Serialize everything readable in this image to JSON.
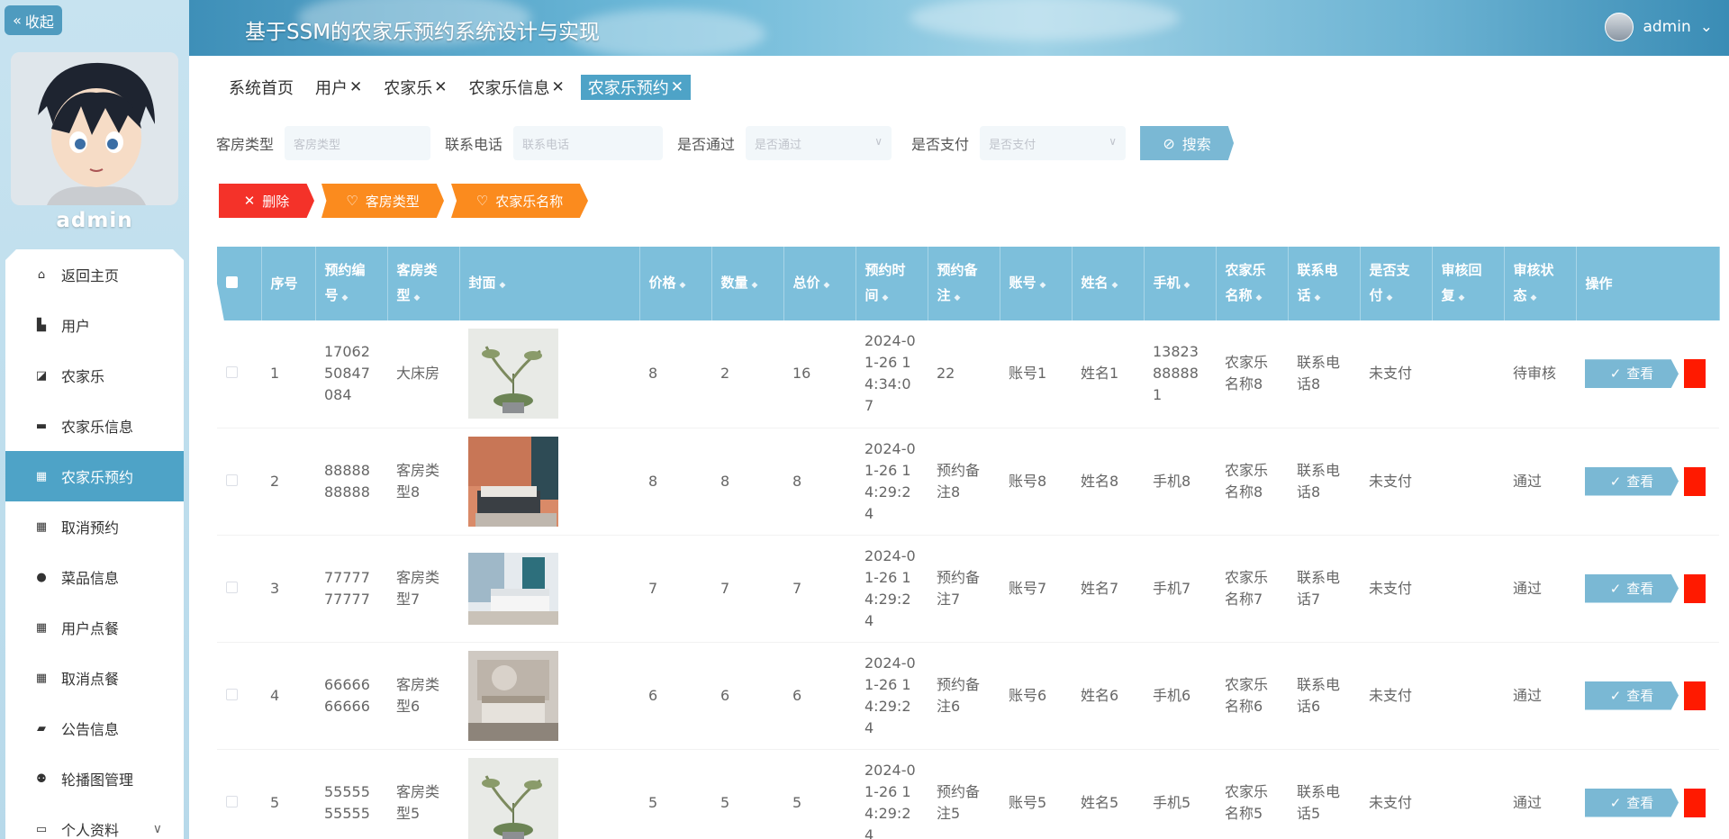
{
  "sidebar": {
    "collapse_label": "收起",
    "username": "admin",
    "menu": [
      {
        "label": "返回主页",
        "icon": "home-icon"
      },
      {
        "label": "用户",
        "icon": "user-group-icon"
      },
      {
        "label": "农家乐",
        "icon": "chart-icon"
      },
      {
        "label": "农家乐信息",
        "icon": "monitor-icon"
      },
      {
        "label": "农家乐预约",
        "icon": "grid-icon",
        "active": true
      },
      {
        "label": "取消预约",
        "icon": "grid-icon"
      },
      {
        "label": "菜品信息",
        "icon": "bulb-icon"
      },
      {
        "label": "用户点餐",
        "icon": "grid-icon"
      },
      {
        "label": "取消点餐",
        "icon": "grid-icon"
      },
      {
        "label": "公告信息",
        "icon": "notice-icon"
      },
      {
        "label": "轮播图管理",
        "icon": "person-icon"
      },
      {
        "label": "个人资料",
        "icon": "profile-icon"
      }
    ]
  },
  "header": {
    "title": "基于SSM的农家乐预约系统设计与实现",
    "user": "admin"
  },
  "tabs": [
    {
      "label": "系统首页",
      "closable": false
    },
    {
      "label": "用户",
      "closable": true
    },
    {
      "label": "农家乐",
      "closable": true
    },
    {
      "label": "农家乐信息",
      "closable": true
    },
    {
      "label": "农家乐预约",
      "closable": true,
      "active": true
    }
  ],
  "search": {
    "room_type_label": "客房类型",
    "room_type_placeholder": "客房类型",
    "phone_label": "联系电话",
    "phone_placeholder": "联系电话",
    "approved_label": "是否通过",
    "approved_placeholder": "是否通过",
    "paid_label": "是否支付",
    "paid_placeholder": "是否支付",
    "search_label": "搜索"
  },
  "actions": {
    "delete_label": "删除",
    "room_type_label": "客房类型",
    "name_label": "农家乐名称"
  },
  "table": {
    "headers": [
      {
        "label": "序号",
        "sortable": false
      },
      {
        "label": "预约编号",
        "sortable": true
      },
      {
        "label": "客房类型",
        "sortable": true
      },
      {
        "label": "封面",
        "sortable": true
      },
      {
        "label": "价格",
        "sortable": true
      },
      {
        "label": "数量",
        "sortable": true
      },
      {
        "label": "总价",
        "sortable": true
      },
      {
        "label": "预约时间",
        "sortable": true
      },
      {
        "label": "预约备注",
        "sortable": true
      },
      {
        "label": "账号",
        "sortable": true
      },
      {
        "label": "姓名",
        "sortable": true
      },
      {
        "label": "手机",
        "sortable": true
      },
      {
        "label": "农家乐名称",
        "sortable": true
      },
      {
        "label": "联系电话",
        "sortable": true
      },
      {
        "label": "是否支付",
        "sortable": true
      },
      {
        "label": "审核回复",
        "sortable": true
      },
      {
        "label": "审核状态",
        "sortable": true
      },
      {
        "label": "操作",
        "sortable": false
      }
    ],
    "view_label": "查看",
    "rows": [
      {
        "idx": "1",
        "order_no": "1706250847084",
        "room_type": "大床房",
        "cover": "plant",
        "price": "8",
        "qty": "2",
        "total": "16",
        "time": "2024-01-26 14:34:07",
        "note": "22",
        "account": "账号1",
        "name": "姓名1",
        "mobile": "13823888881",
        "farm": "农家乐名称8",
        "phone": "联系电话8",
        "paid": "未支付",
        "reply": "",
        "status": "待审核"
      },
      {
        "idx": "2",
        "order_no": "8888888888",
        "room_type": "客房类型8",
        "cover": "bedroom-orange",
        "price": "8",
        "qty": "8",
        "total": "8",
        "time": "2024-01-26 14:29:24",
        "note": "预约备注8",
        "account": "账号8",
        "name": "姓名8",
        "mobile": "手机8",
        "farm": "农家乐名称8",
        "phone": "联系电话8",
        "paid": "未支付",
        "reply": "",
        "status": "通过"
      },
      {
        "idx": "3",
        "order_no": "7777777777",
        "room_type": "客房类型7",
        "cover": "bedroom-blue",
        "price": "7",
        "qty": "7",
        "total": "7",
        "time": "2024-01-26 14:29:24",
        "note": "预约备注7",
        "account": "账号7",
        "name": "姓名7",
        "mobile": "手机7",
        "farm": "农家乐名称7",
        "phone": "联系电话7",
        "paid": "未支付",
        "reply": "",
        "status": "通过"
      },
      {
        "idx": "4",
        "order_no": "6666666666",
        "room_type": "客房类型6",
        "cover": "bedroom-grey",
        "price": "6",
        "qty": "6",
        "total": "6",
        "time": "2024-01-26 14:29:24",
        "note": "预约备注6",
        "account": "账号6",
        "name": "姓名6",
        "mobile": "手机6",
        "farm": "农家乐名称6",
        "phone": "联系电话6",
        "paid": "未支付",
        "reply": "",
        "status": "通过"
      },
      {
        "idx": "5",
        "order_no": "5555555555",
        "room_type": "客房类型5",
        "cover": "plant",
        "price": "5",
        "qty": "5",
        "total": "5",
        "time": "2024-01-26 14:29:24",
        "note": "预约备注5",
        "account": "账号5",
        "name": "姓名5",
        "mobile": "手机5",
        "farm": "农家乐名称5",
        "phone": "联系电话5",
        "paid": "未支付",
        "reply": "",
        "status": "通过"
      }
    ]
  },
  "colors": {
    "accent": "#4ea3c7",
    "header_bg": "#7dbfdb",
    "delete": "#f43229",
    "orange": "#fb8b1e"
  }
}
